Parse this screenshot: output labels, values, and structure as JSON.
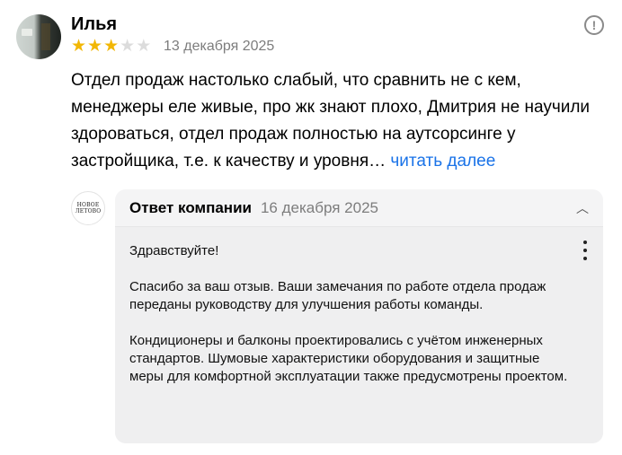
{
  "review": {
    "author": "Илья",
    "rating": 3,
    "rating_max": 5,
    "date": "13 декабря 2025",
    "text": "Отдел продаж настолько слабый, что сравнить не с кем, менеджеры еле живые, про жк знают плохо, Дмитрия не научили здороваться, отдел продаж полностью на аутсорсинге у застройщика, т.е. к качеству и уровня…",
    "read_more": "читать далее",
    "report_icon": "!"
  },
  "company_logo": {
    "text": "НОВОЕ ЛЕТОВО"
  },
  "reply": {
    "title": "Ответ компании",
    "date": "16 декабря 2025",
    "greeting": "Здравствуйте!",
    "paragraph_1": "Спасибо за ваш отзыв. Ваши замечания по работе отдела продаж переданы руководству для улучшения работы команды.",
    "paragraph_2": "Кондиционеры и балконы проектировались с учётом инженерных стандартов. Шумовые характеристики оборудования и защитные меры для комфортной эксплуатации также предусмотрены проектом."
  },
  "colors": {
    "star_filled": "#f2b705",
    "star_empty": "#dcdcdc",
    "link": "#1a73e8",
    "muted": "#7d7d7d"
  }
}
